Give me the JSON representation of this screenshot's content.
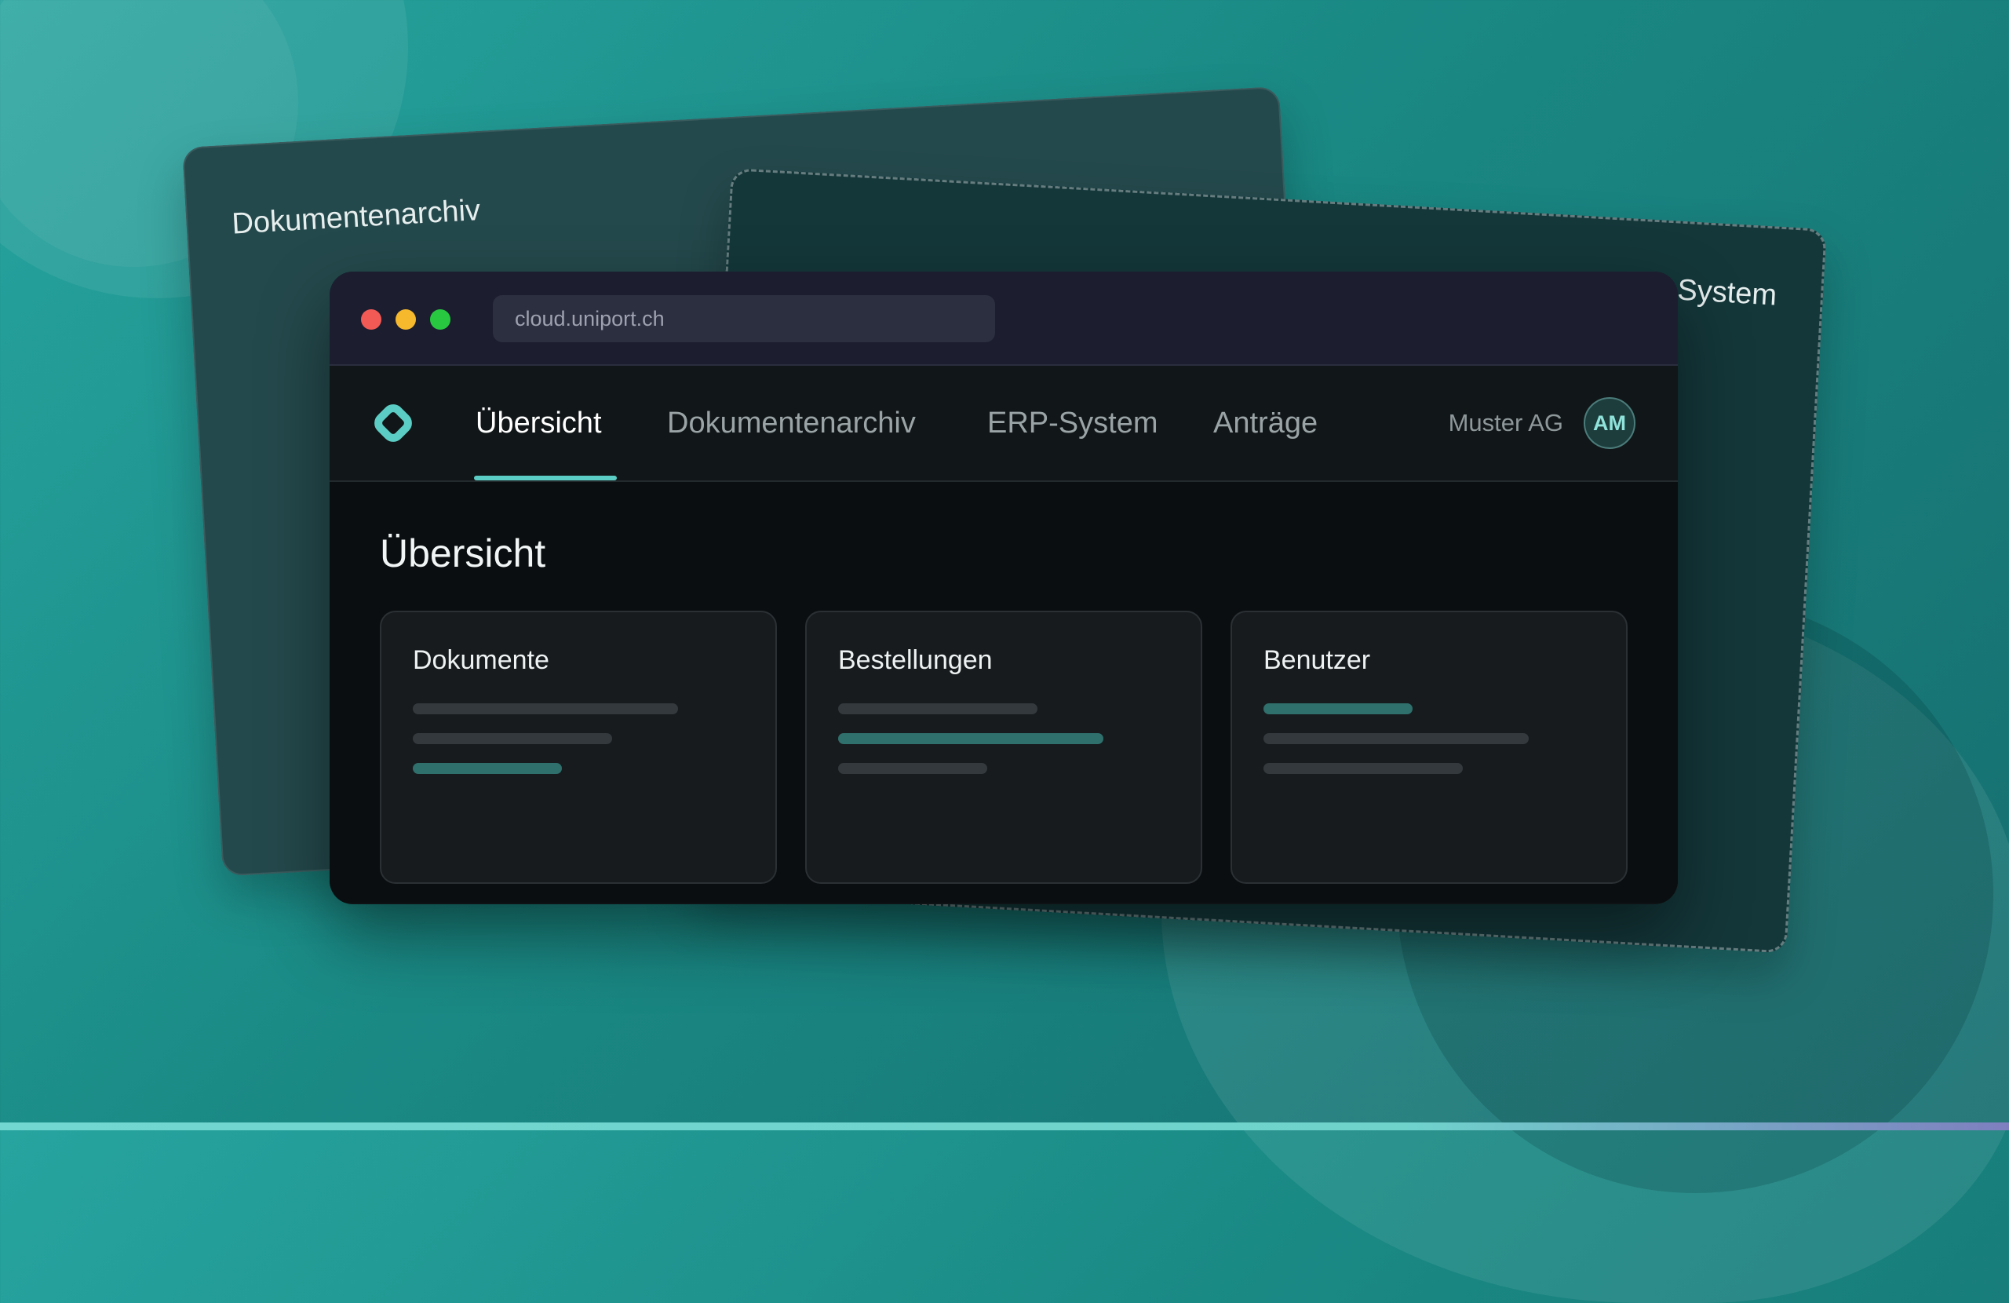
{
  "background_cards": {
    "archive": {
      "title": "Dokumentenarchiv"
    },
    "erp": {
      "title": "ERP-System"
    }
  },
  "browser": {
    "url": "cloud.uniport.ch"
  },
  "nav": {
    "logo_icon": "diamond-ring-logo-icon",
    "tabs": [
      {
        "label": "Übersicht",
        "active": true
      },
      {
        "label": "Dokumentenarchiv",
        "active": false
      },
      {
        "label": "ERP-System",
        "active": false
      },
      {
        "label": "Anträge",
        "active": false
      }
    ],
    "organization": "Muster AG",
    "avatar_initials": "AM"
  },
  "main": {
    "page_title": "Übersicht",
    "tiles": [
      {
        "title": "Dokumente"
      },
      {
        "title": "Bestellungen"
      },
      {
        "title": "Benutzer"
      }
    ]
  },
  "colors": {
    "accent": "#5ccdc4",
    "background": "#1a8984",
    "window": "#0e1214",
    "titlebar": "#1c1e30"
  }
}
